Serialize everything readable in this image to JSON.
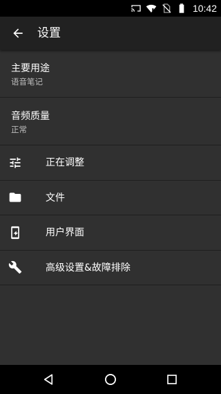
{
  "status_bar": {
    "time": "10:42",
    "icons": [
      "cast-icon",
      "wifi-icon",
      "no-sim-icon",
      "battery-icon"
    ]
  },
  "app_bar": {
    "title": "设置",
    "back_icon": "arrow-back-icon"
  },
  "preferences": [
    {
      "title": "主要用途",
      "summary": "语音笔记"
    },
    {
      "title": "音频质量",
      "summary": "正常"
    }
  ],
  "menu_items": [
    {
      "label": "正在调整",
      "icon": "tune-icon"
    },
    {
      "label": "文件",
      "icon": "folder-icon"
    },
    {
      "label": "用户界面",
      "icon": "phone-ui-icon"
    },
    {
      "label": "高级设置&故障排除",
      "icon": "wrench-icon"
    }
  ],
  "nav_bar": {
    "buttons": [
      "back-triangle-icon",
      "home-circle-icon",
      "recents-square-icon"
    ]
  },
  "colors": {
    "background": "#303030",
    "app_bar": "#212121",
    "status_bar": "#000000",
    "divider": "#1f1f1f",
    "text_primary": "#ffffff",
    "text_secondary": "#bdbdbd"
  }
}
